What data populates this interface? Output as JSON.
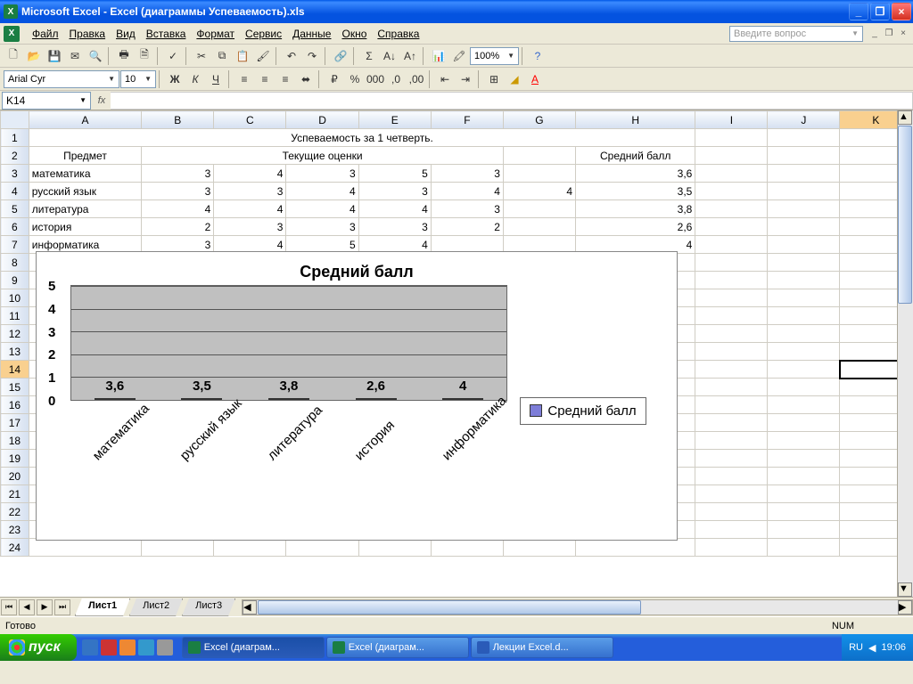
{
  "window": {
    "title": "Microsoft Excel - Excel (диаграммы Успеваемость).xls"
  },
  "menu": {
    "file": "Файл",
    "edit": "Правка",
    "view": "Вид",
    "insert": "Вставка",
    "format": "Формат",
    "tools": "Сервис",
    "data": "Данные",
    "window": "Окно",
    "help": "Справка",
    "ask": "Введите вопрос"
  },
  "tool": {
    "font": "Arial Cyr",
    "size": "10",
    "zoom": "100%"
  },
  "namebox": "K14",
  "columns": [
    "A",
    "B",
    "C",
    "D",
    "E",
    "F",
    "G",
    "H",
    "I",
    "J",
    "K"
  ],
  "sheet": {
    "r1": {
      "A": "Успеваемость за 1 четверть."
    },
    "r2": {
      "A": "Предмет",
      "D": "Текущие оценки",
      "H": "Средний балл"
    },
    "r3": {
      "A": "математика",
      "B": "3",
      "C": "4",
      "D": "3",
      "E": "5",
      "F": "3",
      "H": "3,6"
    },
    "r4": {
      "A": "русский язык",
      "B": "3",
      "C": "3",
      "D": "4",
      "E": "3",
      "F": "4",
      "G": "4",
      "H": "3,5"
    },
    "r5": {
      "A": "литература",
      "B": "4",
      "C": "4",
      "D": "4",
      "E": "4",
      "F": "3",
      "H": "3,8"
    },
    "r6": {
      "A": "история",
      "B": "2",
      "C": "3",
      "D": "3",
      "E": "3",
      "F": "2",
      "H": "2,6"
    },
    "r7": {
      "A": "информатика",
      "B": "3",
      "C": "4",
      "D": "5",
      "E": "4",
      "H": "4"
    }
  },
  "chart_data": {
    "type": "bar",
    "title": "Средний балл",
    "categories": [
      "математика",
      "русский язык",
      "литература",
      "история",
      "информатика"
    ],
    "values": [
      3.6,
      3.5,
      3.8,
      2.6,
      4
    ],
    "value_labels": [
      "3,6",
      "3,5",
      "3,8",
      "2,6",
      "4"
    ],
    "ylim": [
      0,
      5
    ],
    "yticks": [
      "5",
      "4",
      "3",
      "2",
      "1",
      "0"
    ],
    "legend": "Средний балл"
  },
  "tabs": {
    "t1": "Лист1",
    "t2": "Лист2",
    "t3": "Лист3"
  },
  "status": {
    "ready": "Готово",
    "num": "NUM"
  },
  "taskbar": {
    "start": "пуск",
    "t1": "Excel (диаграм...",
    "t2": "Excel (диаграм...",
    "t3": "Лекции Excel.d...",
    "lang": "RU",
    "time": "19:06"
  }
}
